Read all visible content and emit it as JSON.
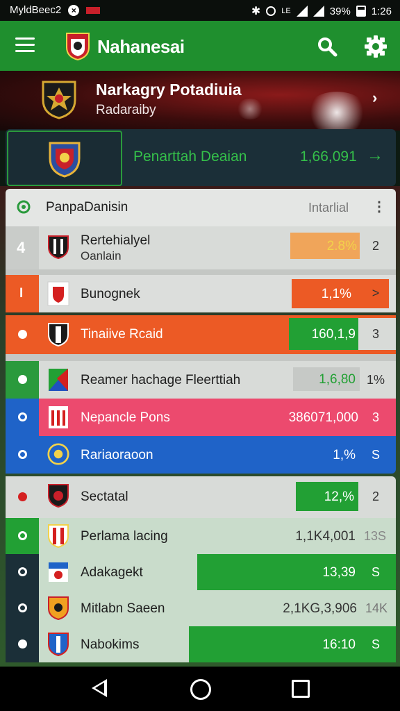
{
  "status_bar": {
    "carrier": "MyldBeec2",
    "battery": "39%",
    "time": "1:26",
    "icons": [
      "x-circle-icon",
      "flag-icon",
      "bluetooth-icon",
      "alarm-icon",
      "lte-icon",
      "signal-icon",
      "battery-icon"
    ]
  },
  "app_bar": {
    "title": "Nahanesai",
    "icons": [
      "menu-icon",
      "search-icon",
      "gear-icon"
    ],
    "color": "#1f8f2e"
  },
  "hero": {
    "title": "Narkagry Potadiuia",
    "subtitle": "Radaraiby",
    "arrow": "›"
  },
  "featured": {
    "label": "Penarttah Deaian",
    "value": "1,66,091",
    "arrow": "→"
  },
  "list": {
    "header_title": "PanpaDanisin",
    "header_tag": "Intarlial",
    "header_more": "⋮",
    "rows": [
      {
        "name": "Rertehialyel",
        "sub": "Oanlain",
        "value": "2.8%",
        "end": "2",
        "indicator": "4"
      },
      {
        "name": "Bunognek",
        "value": "1,1%",
        "end": ">",
        "indicator": "I"
      },
      {
        "name": "Tinaiive Rcaid",
        "value": "160,1,9",
        "end": "3"
      },
      {
        "name": "Reamer hachage Fleerttiah",
        "value": "1,6,80",
        "end": "1%"
      },
      {
        "name": "Nepancle Pons",
        "value": "386071,000",
        "end": "3"
      },
      {
        "name": "Rariaoraoon",
        "value": "1,%",
        "end": "S"
      },
      {
        "name": "Sectatal",
        "value": "12,%",
        "end": "2"
      },
      {
        "name": "Perlama lacing",
        "value": "1,1K4,001",
        "end": "13S"
      },
      {
        "name": "Adakagekt",
        "value": "13,39",
        "end": "S"
      },
      {
        "name": "Mitlabn Saeen",
        "value": "2,1KG,3,906",
        "end": "14K"
      },
      {
        "name": "Nabokims",
        "value": "16:10",
        "end": "S"
      }
    ]
  },
  "nav": {
    "icons": [
      "back-icon",
      "home-icon",
      "recent-apps-icon"
    ]
  },
  "colors": {
    "green": "#1f8f2e",
    "orange": "#ec5a25",
    "pink": "#ec4a6e",
    "blue": "#1f63c8",
    "amber": "#f0a55a"
  }
}
